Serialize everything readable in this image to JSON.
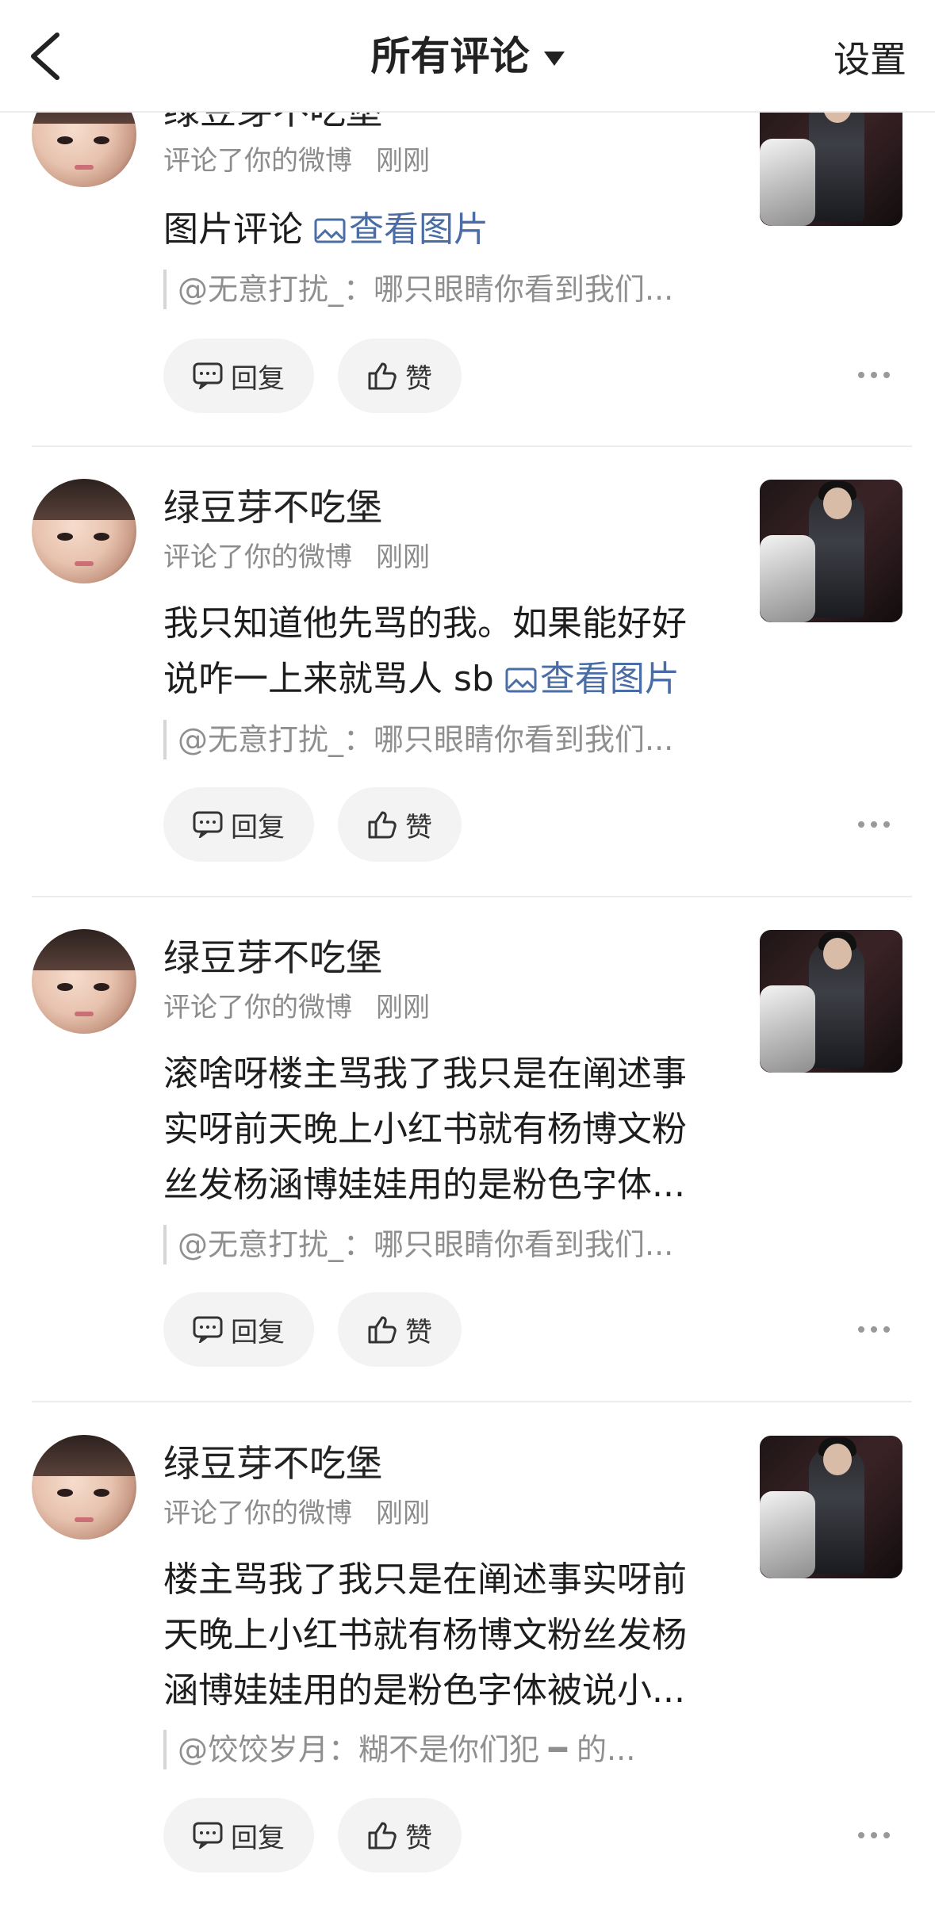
{
  "nav": {
    "title": "所有评论",
    "settings": "设置"
  },
  "labels": {
    "reply": "回复",
    "like": "赞",
    "view_image": "查看图片"
  },
  "comments": [
    {
      "username": "绿豆芽不吃堡",
      "action": "评论了你的微博",
      "time": "刚刚",
      "content": "图片评论",
      "quote": "@无意打扰_：哪只眼睛你看到我们..."
    },
    {
      "username": "绿豆芽不吃堡",
      "action": "评论了你的微博",
      "time": "刚刚",
      "content": "我只知道他先骂的我。如果能好好说咋一上来就骂人 sb",
      "quote": "@无意打扰_：哪只眼睛你看到我们..."
    },
    {
      "username": "绿豆芽不吃堡",
      "action": "评论了你的微博",
      "time": "刚刚",
      "content": "滚啥呀楼主骂我了我只是在阐述事实呀前天晚上小红书就有杨博文粉丝发杨涵博娃娃用的是粉色字体...",
      "quote": "@无意打扰_：哪只眼睛你看到我们..."
    },
    {
      "username": "绿豆芽不吃堡",
      "action": "评论了你的微博",
      "time": "刚刚",
      "content": "楼主骂我了我只是在阐述事实呀前天晚上小红书就有杨博文粉丝发杨涵博娃娃用的是粉色字体被说小...",
      "quote": "@饺饺岁月：糊不是你们犯 ━ 的..."
    }
  ]
}
